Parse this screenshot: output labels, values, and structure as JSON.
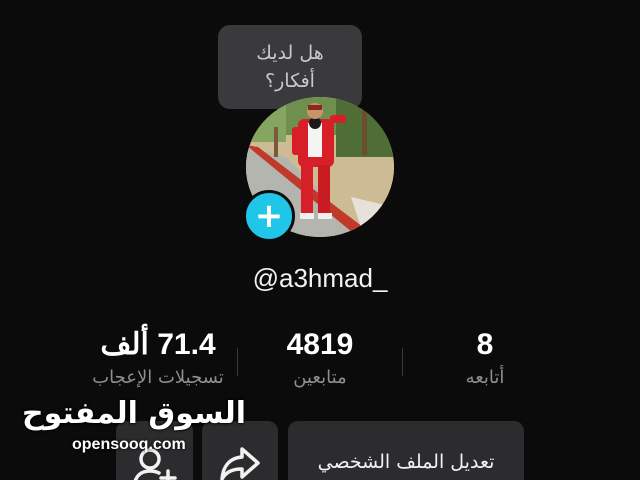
{
  "bubble": {
    "line1": "هل لديك",
    "line2": "أفكار؟"
  },
  "profile": {
    "username": "@a3hmad_"
  },
  "stats": [
    {
      "value": "71.4 ألف",
      "label": "تسجيلات الإعجاب"
    },
    {
      "value": "4819",
      "label": "متابعين"
    },
    {
      "value": "8",
      "label": "أتابعه"
    }
  ],
  "actions": {
    "edit_label": "تعديل الملف الشخصي"
  },
  "watermark": {
    "arabic": "السوق المفتوح",
    "latin": "opensooq.com"
  },
  "colors": {
    "accent": "#1fc6e8",
    "background": "#0b0b0b",
    "button": "#2c2c2e"
  }
}
